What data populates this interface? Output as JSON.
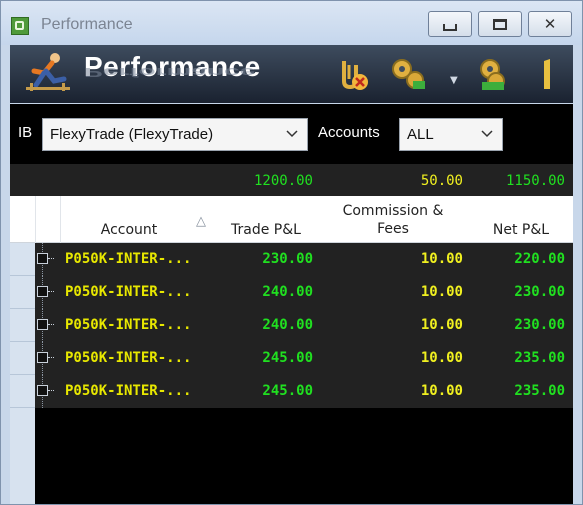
{
  "window": {
    "title": "Performance"
  },
  "banner": {
    "title": "Performance",
    "icons": [
      "runner-icon",
      "paperclip-delete-icon",
      "gears-icon",
      "gears-add-icon",
      "bar-icon"
    ]
  },
  "filters": {
    "broker_label": "IB",
    "broker_value": "FlexyTrade (FlexyTrade)",
    "accounts_label": "Accounts",
    "accounts_value": "ALL"
  },
  "totals": {
    "trade_pl": "1200.00",
    "commission_fees": "50.00",
    "net_pl": "1150.00"
  },
  "columns": {
    "account": "Account",
    "trade_pl": "Trade P&L",
    "commission_fees": "Commission & Fees",
    "net_pl": "Net P&L"
  },
  "rows": [
    {
      "account": "P050K-INTER-...",
      "trade_pl": "230.00",
      "commission": "10.00",
      "net_pl": "220.00"
    },
    {
      "account": "P050K-INTER-...",
      "trade_pl": "240.00",
      "commission": "10.00",
      "net_pl": "230.00"
    },
    {
      "account": "P050K-INTER-...",
      "trade_pl": "240.00",
      "commission": "10.00",
      "net_pl": "230.00"
    },
    {
      "account": "P050K-INTER-...",
      "trade_pl": "245.00",
      "commission": "10.00",
      "net_pl": "235.00"
    },
    {
      "account": "P050K-INTER-...",
      "trade_pl": "245.00",
      "commission": "10.00",
      "net_pl": "235.00"
    }
  ],
  "colors": {
    "green": "#20e020",
    "yellow": "#f0f020",
    "row_bg": "#222222"
  }
}
